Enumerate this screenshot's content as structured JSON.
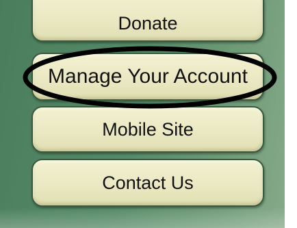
{
  "nav": {
    "donate_label": "Donate",
    "manage_account_label": "Manage Your Account",
    "mobile_site_label": "Mobile Site",
    "contact_us_label": "Contact Us"
  },
  "annotation": {
    "shape": "ellipse",
    "color": "#000000",
    "target": "manage-account-button"
  },
  "colors": {
    "panel_green": "#558a67",
    "button_fill": "#ebe9c3",
    "button_border": "#3a5a3d"
  }
}
